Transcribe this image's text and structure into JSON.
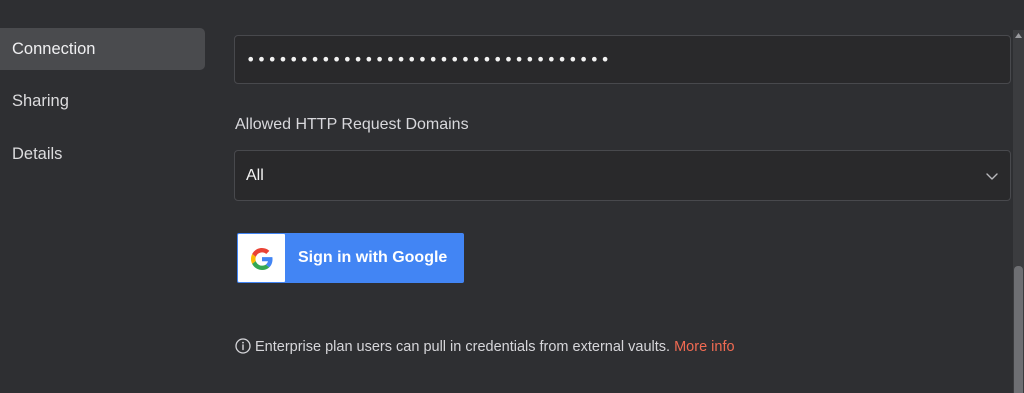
{
  "sidebar": {
    "items": [
      {
        "label": "Connection",
        "active": true
      },
      {
        "label": "Sharing",
        "active": false
      },
      {
        "label": "Details",
        "active": false
      }
    ]
  },
  "form": {
    "password_value": "••••••••••••••••••••••••••••••••••",
    "domains_label": "Allowed HTTP Request Domains",
    "domains_selected": "All"
  },
  "google_button": {
    "label": "Sign in with Google",
    "icon": "google-logo-icon"
  },
  "info": {
    "icon": "info-circle-icon",
    "text": "Enterprise plan users can pull in credentials from external vaults.",
    "link_label": "More info"
  },
  "colors": {
    "background": "#2e2f32",
    "sidebar_active": "#4a4b4e",
    "input_background": "#29292b",
    "google_blue": "#4285f4",
    "link_accent": "#f06a52"
  }
}
